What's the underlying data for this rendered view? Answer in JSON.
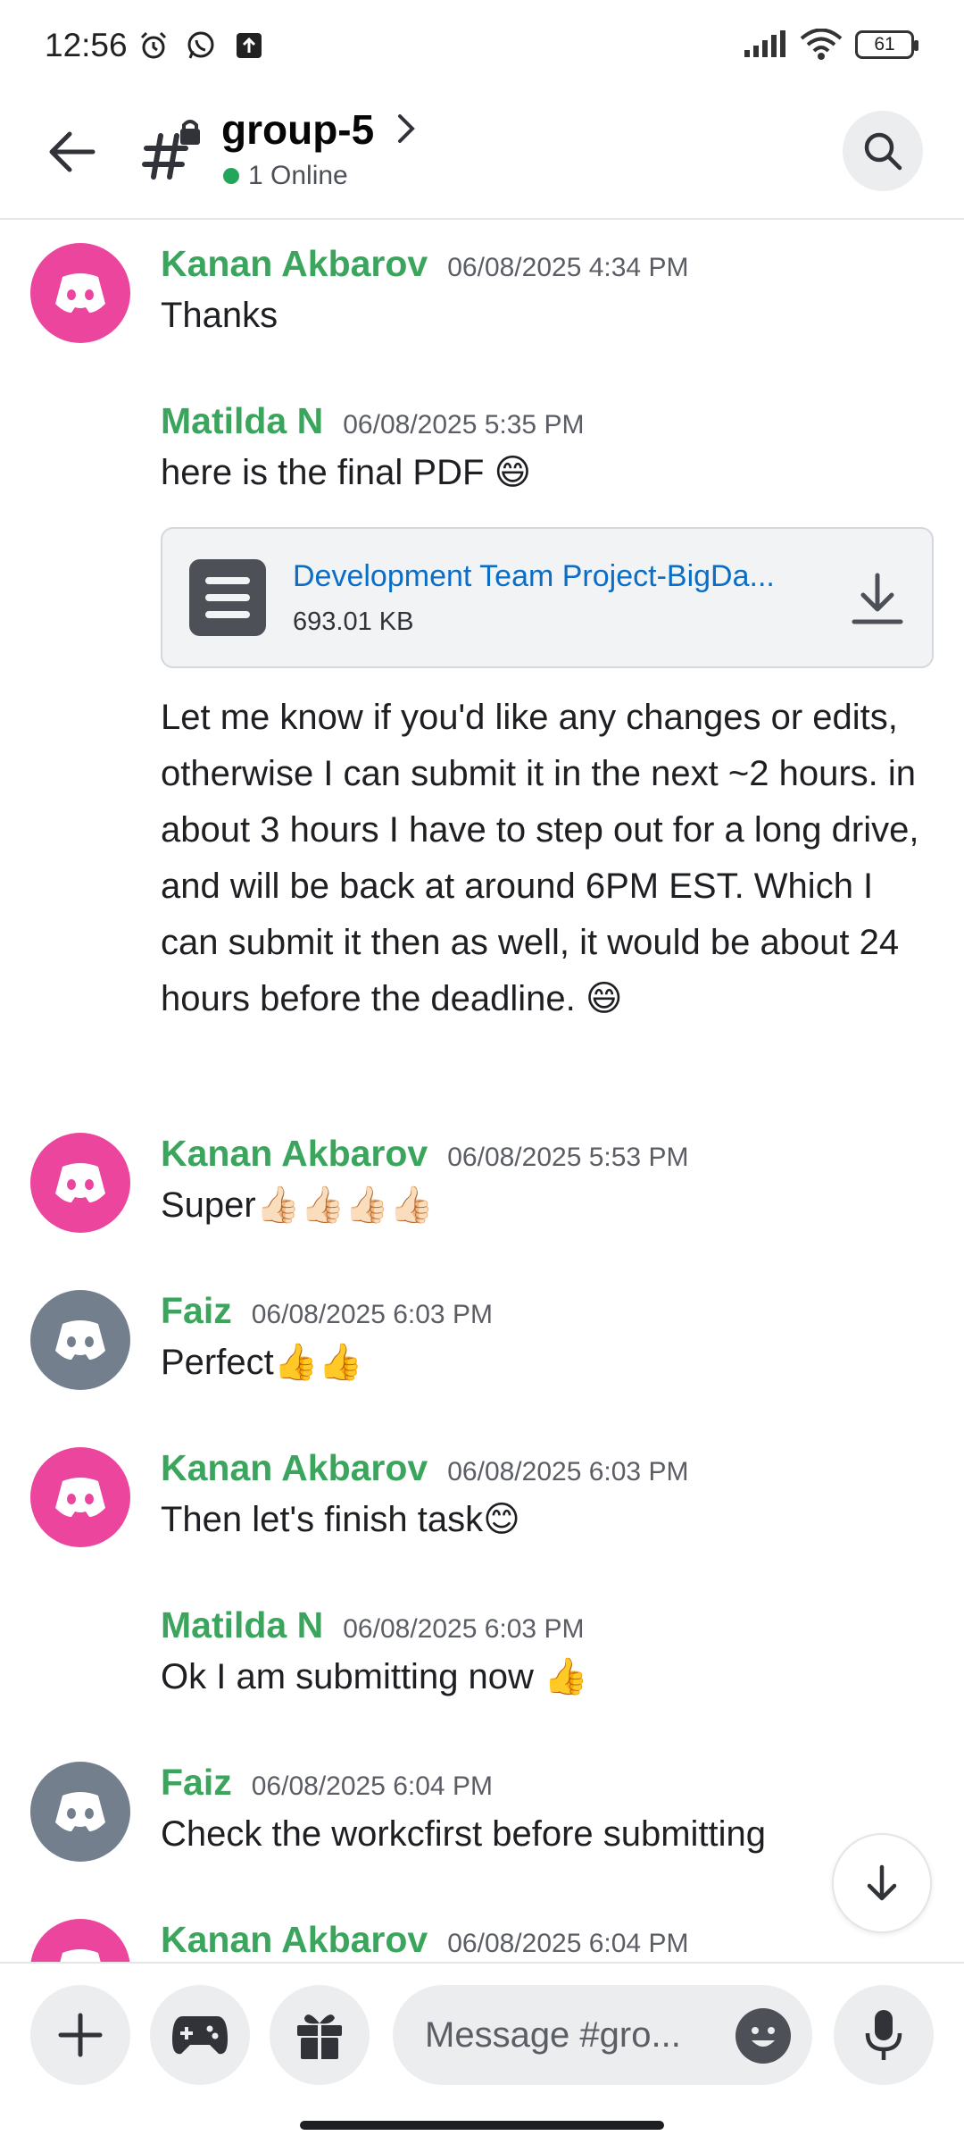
{
  "status_bar": {
    "time": "12:56",
    "battery": "61",
    "icons": [
      "alarm-icon",
      "whatsapp-icon",
      "upload-icon",
      "signal-icon",
      "wifi-icon",
      "battery-icon"
    ]
  },
  "header": {
    "channel_name": "group-5",
    "online_text": "1 Online",
    "icons": [
      "back-arrow-icon",
      "locked-channel-icon",
      "chevron-right-icon",
      "search-icon"
    ]
  },
  "messages": [
    {
      "author": "Kanan Akbarov",
      "timestamp": "06/08/2025 4:34 PM",
      "text": "Thanks",
      "avatar_color": "#eb459e"
    },
    {
      "author": "Matilda N",
      "timestamp": "06/08/2025 5:35 PM",
      "text": "here is the final PDF 😄"
    },
    {
      "text": "Let me know if you'd like any changes or edits, otherwise I can submit it in the next ~2 hours. in about 3 hours I have to step out for a long drive, and will be back at around 6PM EST. Which I can submit it then as well, it would be about 24 hours before the deadline. 😄"
    },
    {
      "author": "Kanan Akbarov",
      "timestamp": "06/08/2025 5:53 PM",
      "text": "Super👍🏻👍🏻👍🏻👍🏻",
      "avatar_color": "#eb459e"
    },
    {
      "author": "Faiz",
      "timestamp": "06/08/2025 6:03 PM",
      "text": "Perfect👍👍",
      "avatar_color": "#747f8d"
    },
    {
      "author": "Kanan Akbarov",
      "timestamp": "06/08/2025 6:03 PM",
      "text": "Then let's finish task😊",
      "avatar_color": "#eb459e"
    },
    {
      "author": "Matilda N",
      "timestamp": "06/08/2025 6:03 PM",
      "text": "Ok I am submitting now 👍"
    },
    {
      "author": "Faiz",
      "timestamp": "06/08/2025 6:04 PM",
      "text": "Check the workcfirst before submitting",
      "avatar_color": "#747f8d"
    },
    {
      "author": "Kanan Akbarov",
      "timestamp": "06/08/2025 6:04 PM",
      "avatar_color": "#eb459e"
    }
  ],
  "attachment": {
    "file_name": "Development Team Project-BigDa...",
    "file_size": "693.01 KB"
  },
  "composer": {
    "placeholder": "Message #gro...",
    "icons": [
      "plus-icon",
      "gamepad-icon",
      "gift-icon",
      "emoji-icon",
      "microphone-icon"
    ]
  },
  "colors": {
    "author_green": "#3ba55d",
    "avatar_pink": "#eb459e",
    "avatar_gray": "#747f8d",
    "link_blue": "#0a6ec7",
    "online_green": "#23a55a"
  }
}
